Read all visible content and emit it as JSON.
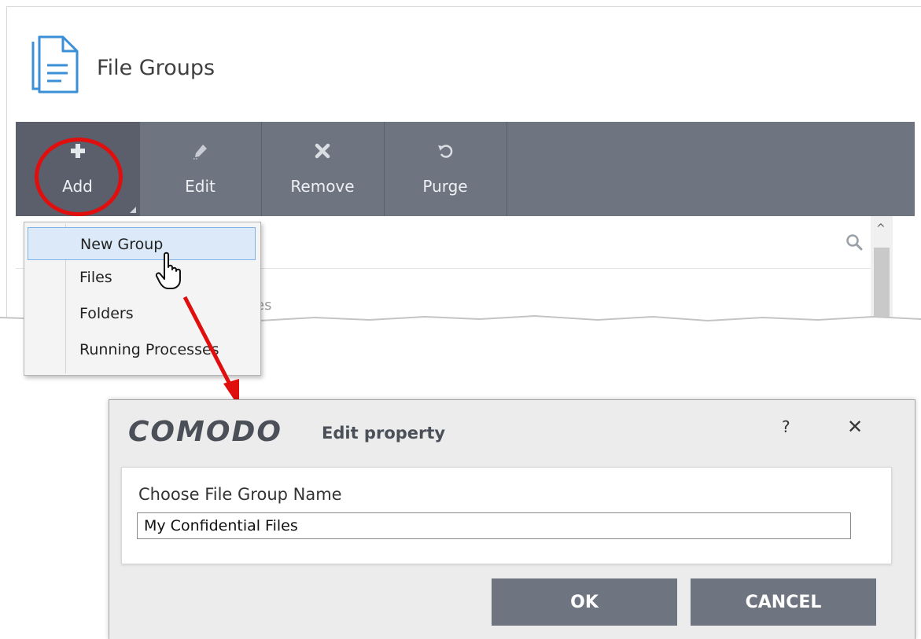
{
  "window": {
    "title": "File Groups",
    "icon": "file-group-icon"
  },
  "toolbar": {
    "buttons": [
      {
        "label": "Add",
        "icon": "plus-icon"
      },
      {
        "label": "Edit",
        "icon": "pencil-icon"
      },
      {
        "label": "Remove",
        "icon": "x-icon"
      },
      {
        "label": "Purge",
        "icon": "refresh-icon"
      }
    ]
  },
  "list": {
    "search_icon": "search-icon",
    "partial_text": "es"
  },
  "add_menu": {
    "items": [
      {
        "label": "New Group"
      },
      {
        "label": "Files"
      },
      {
        "label": "Folders"
      },
      {
        "label": "Running Processes"
      }
    ],
    "highlighted": "New Group"
  },
  "dialog": {
    "brand": "COMODO",
    "title": "Edit property",
    "help_label": "?",
    "close_label": "✕",
    "field_label": "Choose File Group Name",
    "field_value": "My Confidential Files",
    "ok_label": "OK",
    "cancel_label": "CANCEL"
  },
  "colors": {
    "toolbar_bg": "#6e7480",
    "annotation": "#e10e0e",
    "menu_highlight": "#dbe9f8"
  }
}
